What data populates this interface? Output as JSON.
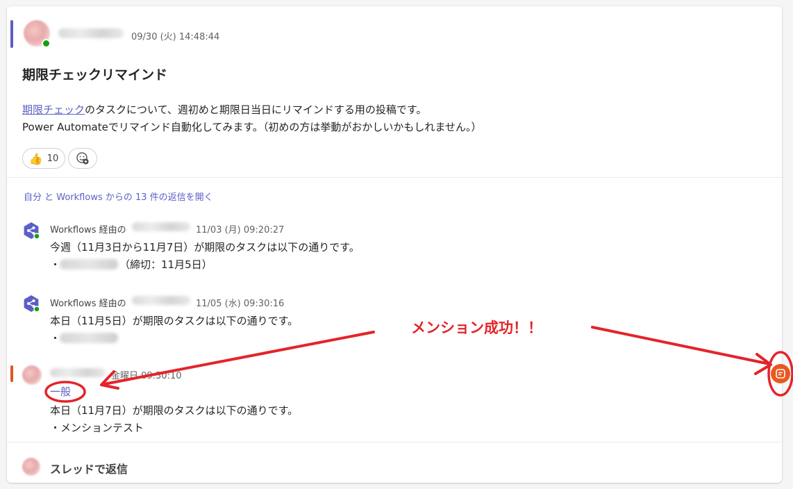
{
  "post": {
    "timestamp": "09/30 (火) 14:48:44",
    "title": "期限チェックリマインド",
    "body_link": "期限チェック",
    "body_line1_rest": "のタスクについて、週初めと期限日当日にリマインドする用の投稿です。",
    "body_line2": "Power Automateでリマインド自動化してみます。（初めの方は挙動がおかしいかもしれません。）",
    "reactions": [
      {
        "emoji": "👍",
        "count": "10"
      }
    ]
  },
  "thread": {
    "open_replies": "自分 と Workflows からの 13 件の返信を開く",
    "replies": [
      {
        "sender_prefix": "Workflows 経由の",
        "timestamp": "11/03 (月) 09:20:27",
        "line1": "今週（11月3日から11月7日）が期限のタスクは以下の通りです。",
        "bullet": "・",
        "bullet_suffix": "（締切：11月5日）"
      },
      {
        "sender_prefix": "Workflows 経由の",
        "timestamp": "11/05 (水) 09:30:16",
        "line1": "本日（11月5日）が期限のタスクは以下の通りです。",
        "bullet": "・"
      },
      {
        "timestamp": "金曜日 09:30:10",
        "channel": "一般",
        "line1": "本日（11月7日）が期限のタスクは以下の通りです。",
        "line2": "・メンションテスト"
      }
    ],
    "reply_in_thread": "スレッドで返信"
  },
  "annotation": {
    "text": "メンション成功！！",
    "color": "#e3242b"
  },
  "colors": {
    "accent_purple": "#5b5fc7",
    "accent_orange": "#dc5a1e",
    "presence_green": "#13a10e",
    "fab_orange": "#e9581e"
  }
}
